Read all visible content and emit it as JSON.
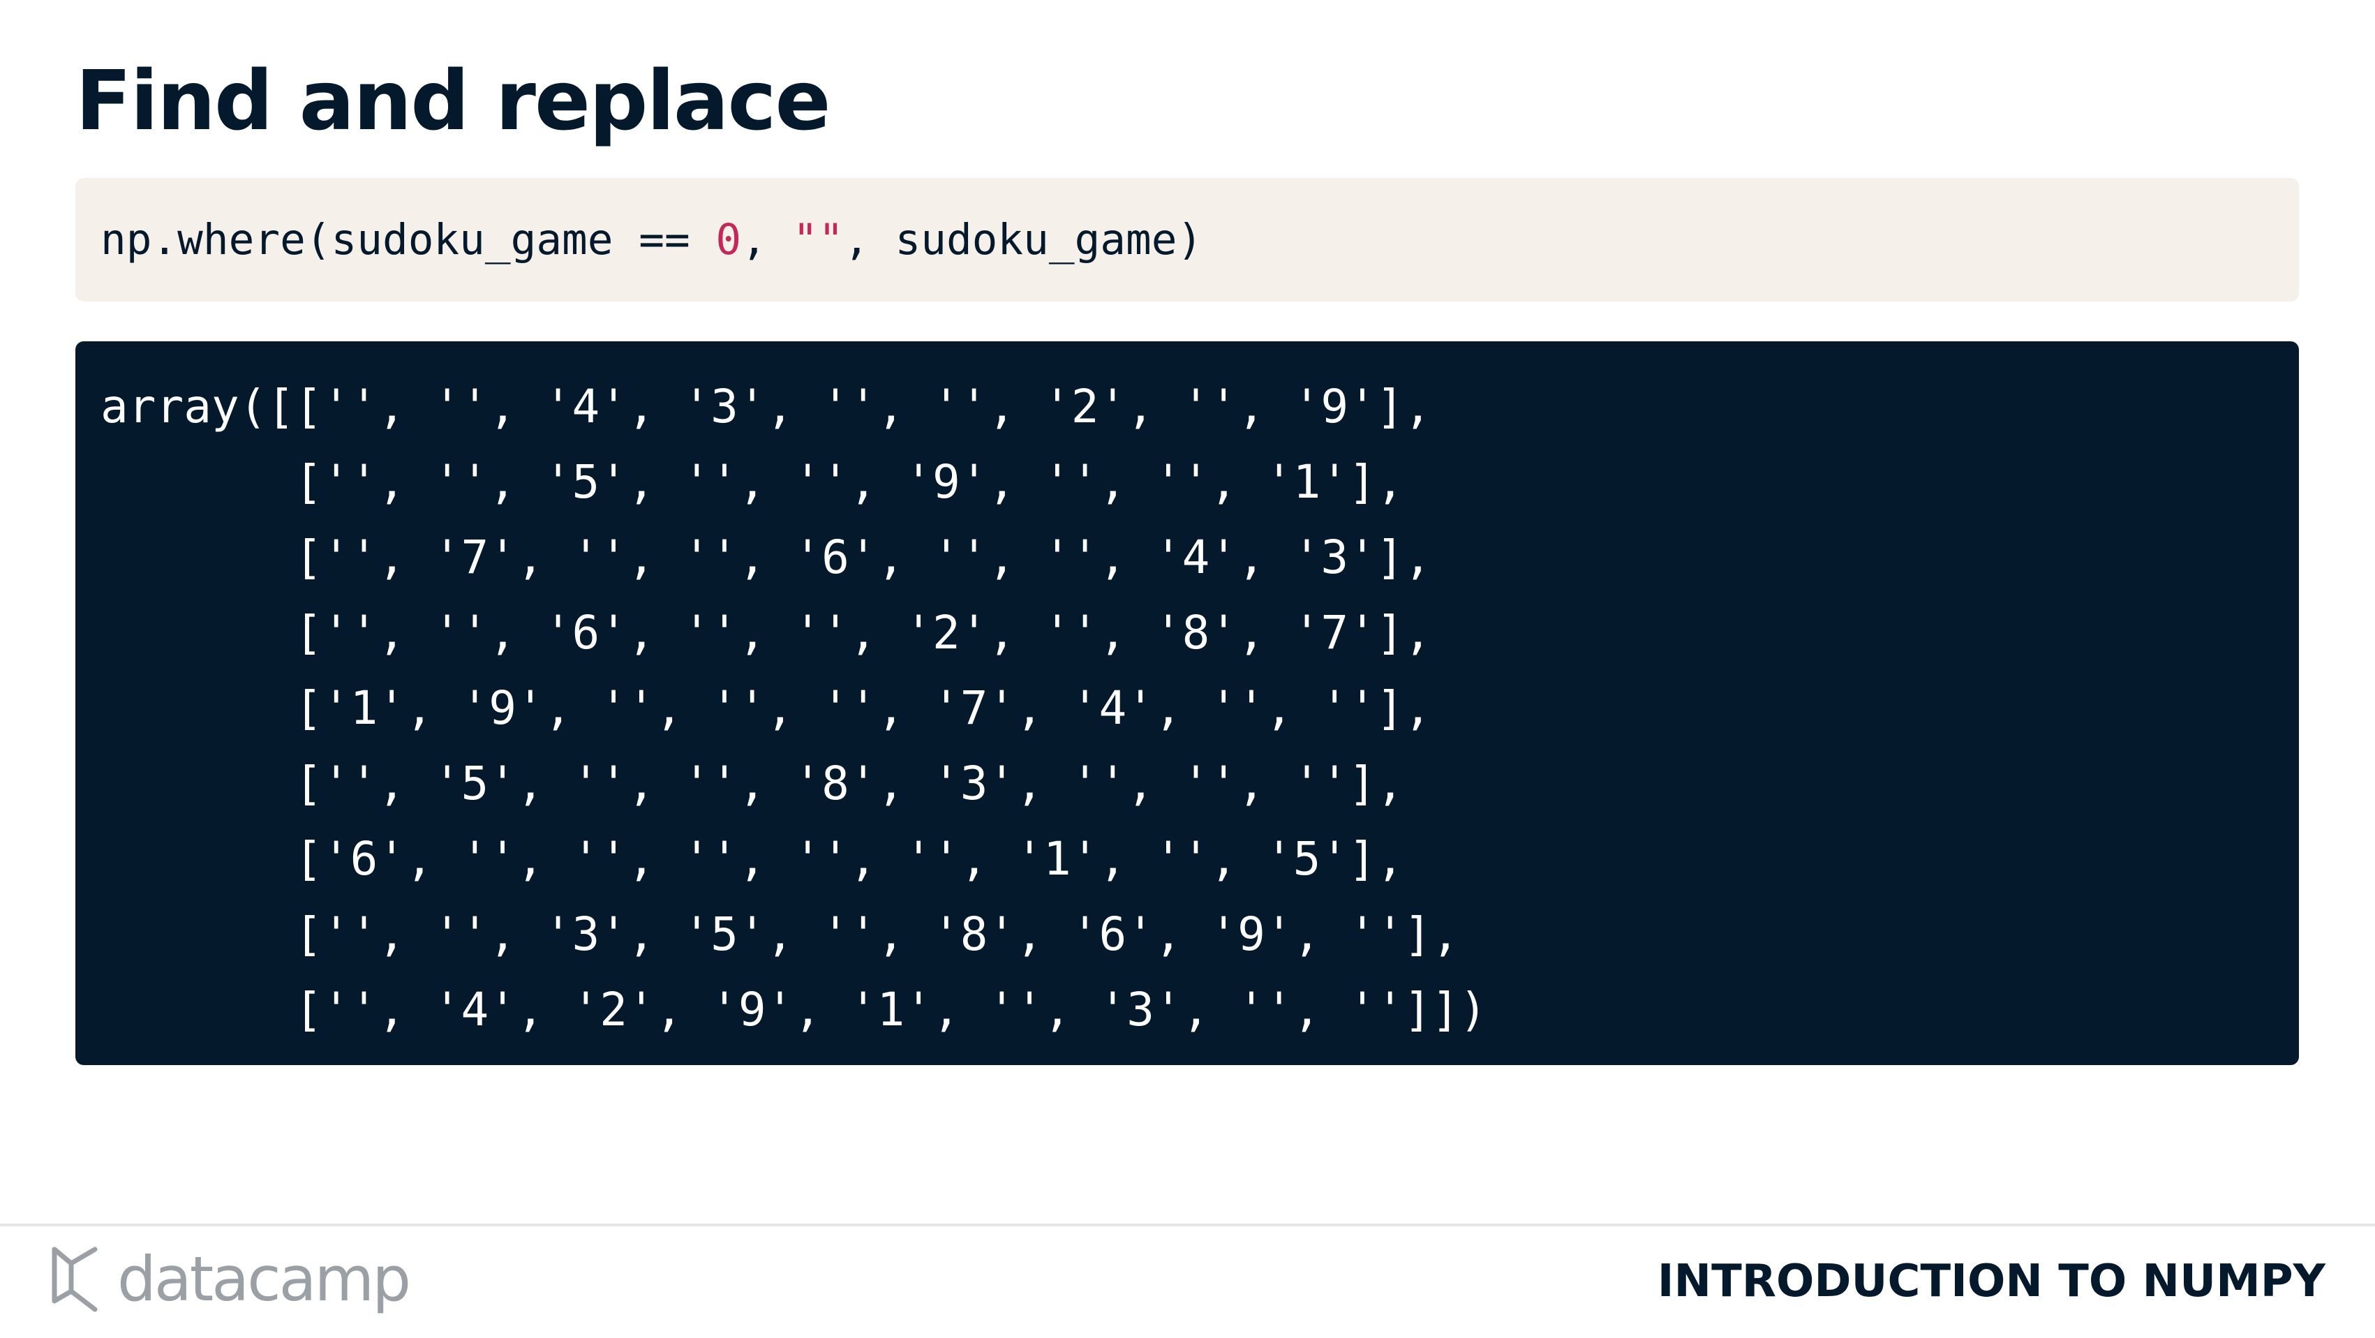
{
  "slide": {
    "title": "Find and replace"
  },
  "code_input": {
    "tokens": {
      "before": "np.where(sudoku_game == ",
      "number": "0",
      "sep1": ", ",
      "string": "\"\"",
      "after": ", sudoku_game)"
    }
  },
  "code_output": {
    "lines": [
      "array([['', '', '4', '3', '', '', '2', '', '9'],",
      "       ['', '', '5', '', '', '9', '', '', '1'],",
      "       ['', '7', '', '', '6', '', '', '4', '3'],",
      "       ['', '', '6', '', '', '2', '', '8', '7'],",
      "       ['1', '9', '', '', '', '7', '4', '', ''],",
      "       ['', '5', '', '', '8', '3', '', '', ''],",
      "       ['6', '', '', '', '', '', '1', '', '5'],",
      "       ['', '', '3', '5', '', '8', '6', '9', ''],",
      "       ['', '4', '2', '9', '1', '', '3', '', '']])"
    ]
  },
  "footer": {
    "brand": "datacamp",
    "course": "INTRODUCTION TO NUMPY"
  },
  "colors": {
    "navy": "#05192d",
    "code_bg": "#f5f1ea",
    "literal": "#c4285a",
    "brand_gray": "#9aa0a6"
  }
}
